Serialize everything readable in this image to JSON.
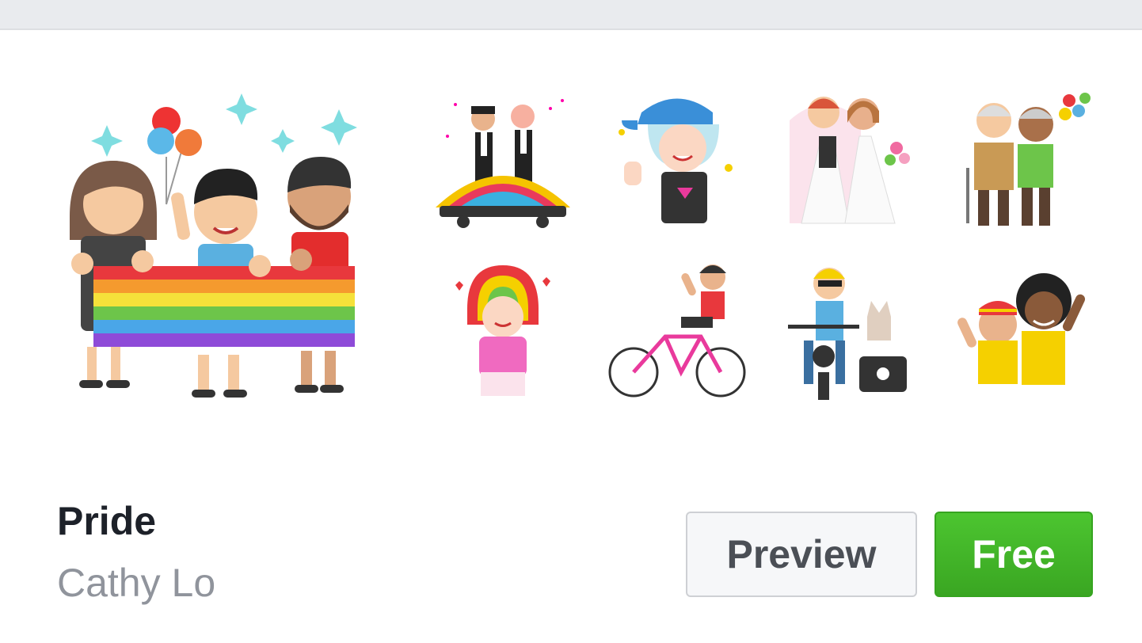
{
  "pack": {
    "title": "Pride",
    "author": "Cathy Lo",
    "preview_label": "Preview",
    "free_label": "Free"
  },
  "stickers": [
    {
      "name": "parade-float"
    },
    {
      "name": "cap-wave"
    },
    {
      "name": "brides"
    },
    {
      "name": "elderly-couple"
    },
    {
      "name": "rainbow-hair-girl"
    },
    {
      "name": "cyclist"
    },
    {
      "name": "motorcycle-dog"
    },
    {
      "name": "friends-cheer"
    }
  ],
  "colors": {
    "free_button": "#42b72a",
    "title": "#1d2129",
    "author": "#90949c",
    "topbar": "#e9ebee"
  }
}
